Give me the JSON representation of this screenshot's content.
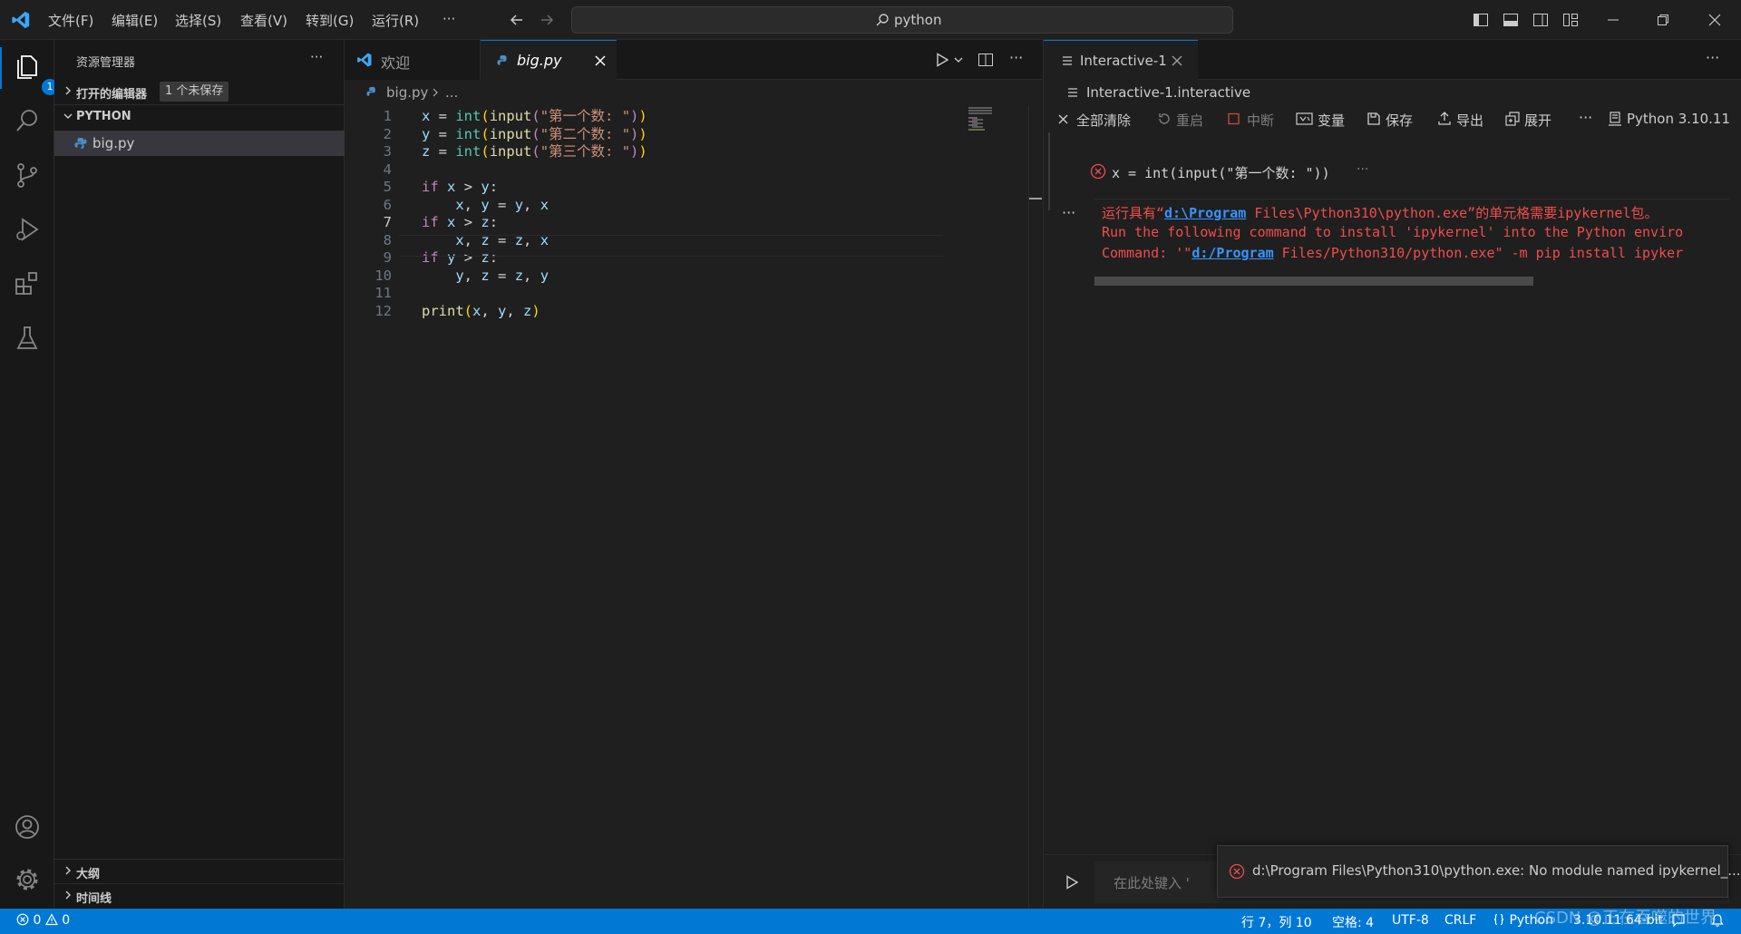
{
  "titlebar": {
    "menu": [
      "文件(F)",
      "编辑(E)",
      "选择(S)",
      "查看(V)",
      "转到(G)",
      "运行(R)",
      "···"
    ],
    "search_text": "python"
  },
  "activitybar": {
    "explorer_badge": "1"
  },
  "sidebar": {
    "title": "资源管理器",
    "more": "···",
    "open_editors_label": "打开的编辑器",
    "unsaved_badge": "1 个未保存",
    "folder_label": "PYTHON",
    "file": "big.py",
    "outline_label": "大纲",
    "timeline_label": "时间线"
  },
  "editor": {
    "tabs": [
      {
        "label": "欢迎",
        "active": false
      },
      {
        "label": "big.py",
        "active": true
      }
    ],
    "breadcrumb": [
      "big.py",
      "..."
    ],
    "lines": [
      {
        "n": "1",
        "tokens": [
          [
            "v",
            "x"
          ],
          [
            "o",
            " = "
          ],
          [
            "t",
            "int"
          ],
          [
            "p1",
            "("
          ],
          [
            "f",
            "input"
          ],
          [
            "k",
            "("
          ],
          [
            "s",
            "\"第一个数: \""
          ],
          [
            "k",
            ")"
          ],
          [
            "p1",
            ")"
          ]
        ]
      },
      {
        "n": "2",
        "tokens": [
          [
            "v",
            "y"
          ],
          [
            "o",
            " = "
          ],
          [
            "t",
            "int"
          ],
          [
            "p1",
            "("
          ],
          [
            "f",
            "input"
          ],
          [
            "k",
            "("
          ],
          [
            "s",
            "\"第二个数: \""
          ],
          [
            "k",
            ")"
          ],
          [
            "p1",
            ")"
          ]
        ]
      },
      {
        "n": "3",
        "tokens": [
          [
            "v",
            "z"
          ],
          [
            "o",
            " = "
          ],
          [
            "t",
            "int"
          ],
          [
            "p1",
            "("
          ],
          [
            "f",
            "input"
          ],
          [
            "k",
            "("
          ],
          [
            "s",
            "\"第三个数: \""
          ],
          [
            "k",
            ")"
          ],
          [
            "p1",
            ")"
          ]
        ]
      },
      {
        "n": "4",
        "tokens": []
      },
      {
        "n": "5",
        "tokens": [
          [
            "k",
            "if"
          ],
          [
            "o",
            " "
          ],
          [
            "v",
            "x"
          ],
          [
            "o",
            " > "
          ],
          [
            "v",
            "y"
          ],
          [
            "o",
            ":"
          ]
        ]
      },
      {
        "n": "6",
        "tokens": [
          [
            "o",
            "    "
          ],
          [
            "v",
            "x"
          ],
          [
            "o",
            ", "
          ],
          [
            "v",
            "y"
          ],
          [
            "o",
            " = "
          ],
          [
            "v",
            "y"
          ],
          [
            "o",
            ", "
          ],
          [
            "v",
            "x"
          ]
        ]
      },
      {
        "n": "7",
        "tokens": [
          [
            "k",
            "if"
          ],
          [
            "o",
            " "
          ],
          [
            "v",
            "x"
          ],
          [
            "o",
            " > "
          ],
          [
            "v",
            "z"
          ],
          [
            "o",
            ":"
          ]
        ]
      },
      {
        "n": "8",
        "tokens": [
          [
            "o",
            "    "
          ],
          [
            "v",
            "x"
          ],
          [
            "o",
            ", "
          ],
          [
            "v",
            "z"
          ],
          [
            "o",
            " = "
          ],
          [
            "v",
            "z"
          ],
          [
            "o",
            ", "
          ],
          [
            "v",
            "x"
          ]
        ]
      },
      {
        "n": "9",
        "tokens": [
          [
            "k",
            "if"
          ],
          [
            "o",
            " "
          ],
          [
            "v",
            "y"
          ],
          [
            "o",
            " > "
          ],
          [
            "v",
            "z"
          ],
          [
            "o",
            ":"
          ]
        ]
      },
      {
        "n": "10",
        "tokens": [
          [
            "o",
            "    "
          ],
          [
            "v",
            "y"
          ],
          [
            "o",
            ", "
          ],
          [
            "v",
            "z"
          ],
          [
            "o",
            " = "
          ],
          [
            "v",
            "z"
          ],
          [
            "o",
            ", "
          ],
          [
            "v",
            "y"
          ]
        ]
      },
      {
        "n": "11",
        "tokens": []
      },
      {
        "n": "12",
        "tokens": [
          [
            "f",
            "print"
          ],
          [
            "p1",
            "("
          ],
          [
            "v",
            "x"
          ],
          [
            "o",
            ", "
          ],
          [
            "v",
            "y"
          ],
          [
            "o",
            ", "
          ],
          [
            "v",
            "z"
          ],
          [
            "p1",
            ")"
          ]
        ]
      }
    ]
  },
  "interactive": {
    "tab_label": "Interactive-1",
    "file_label": "Interactive-1.interactive",
    "toolbar": {
      "clear_all": "全部清除",
      "restart": "重启",
      "interrupt": "中断",
      "variables": "变量",
      "save": "保存",
      "export": "导出",
      "expand": "展开",
      "more": "···",
      "kernel": "Python 3.10.11"
    },
    "cell_code": "x = int(input(\"第一个数: \"))",
    "cell_more": "···",
    "output_more": "···",
    "error": {
      "line1_pre": "运行具有“",
      "line1_link": "d:\\Program",
      "line1_post": " Files\\Python310\\python.exe”的单元格需要ipykernel包。",
      "line2": "Run the following command to install 'ipykernel' into the Python enviro",
      "line3_pre": "Command: '\"",
      "line3_link": "d:/Program",
      "line3_post": " Files/Python310/python.exe\" -m pip install ipyker"
    },
    "input_placeholder": "在此处键入 '"
  },
  "notification": {
    "message": "d:\\Program Files\\Python310\\python.exe: No module named ipykernel_..."
  },
  "statusbar": {
    "errors": "0",
    "warnings": "0",
    "position": "行 7，列 10",
    "spaces": "空格: 4",
    "encoding": "UTF-8",
    "eol": "CRLF",
    "language": "Python",
    "interpreter": "3.10.11 64-bit"
  },
  "watermark": "CSDN @正在吞噬的世界"
}
